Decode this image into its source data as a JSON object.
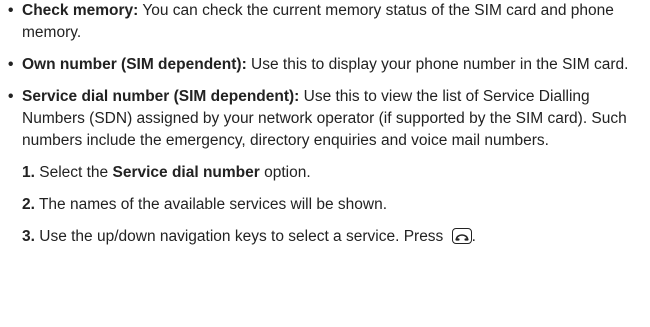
{
  "bullets": [
    {
      "term": "Check memory:",
      "text": " You can check the current memory status of the SIM card and phone memory."
    },
    {
      "term": "Own number (SIM dependent):",
      "text": " Use this to display your phone number in the SIM card."
    },
    {
      "term": "Service dial number (SIM dependent):",
      "text": " Use this to view the list of Service Dialling Numbers (SDN) assigned by your network operator (if supported by the SIM card). Such numbers include the emergency, directory enquiries and voice mail numbers."
    }
  ],
  "steps": [
    {
      "num": "1.",
      "pre": " Select the ",
      "option": "Service dial number",
      "post": " option."
    },
    {
      "num": "2.",
      "text": " The names of the available services will be shown."
    },
    {
      "num": "3.",
      "text": " Use the up/down navigation keys to select a service. Press ",
      "end": "."
    }
  ],
  "icons": {
    "call_key": "call-send-key-icon"
  },
  "bullet_glyph": "•"
}
